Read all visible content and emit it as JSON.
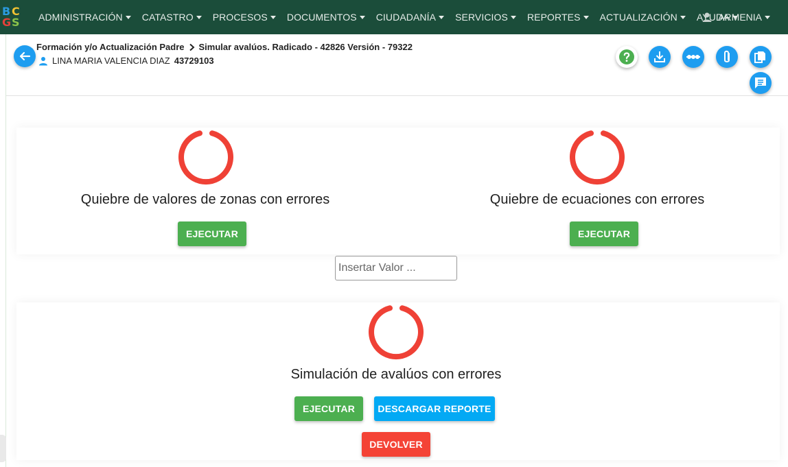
{
  "app": {
    "logo_letters": [
      "B",
      "C",
      "G",
      "S"
    ]
  },
  "navbar": {
    "items": [
      {
        "label": "ADMINISTRACIÓN"
      },
      {
        "label": "CATASTRO"
      },
      {
        "label": "PROCESOS"
      },
      {
        "label": "DOCUMENTOS"
      },
      {
        "label": "CIUDADANÍA"
      },
      {
        "label": "SERVICIOS"
      },
      {
        "label": "REPORTES"
      },
      {
        "label": "ACTUALIZACIÓN"
      },
      {
        "label": "AYUDA"
      }
    ],
    "user": {
      "label": "ARMENIA",
      "icon": "user-icon"
    }
  },
  "header": {
    "breadcrumb": {
      "parent": "Formación y/o Actualización Padre",
      "separator_icon": "chevron-right-icon",
      "current": "Simular avalúos. Radicado - 42826 Versión - 79322"
    },
    "person": {
      "icon": "person-icon",
      "name": "LINA MARIA VALENCIA DIAZ",
      "id": "43729103"
    },
    "actions": [
      {
        "icon": "help-icon"
      },
      {
        "icon": "download-icon"
      },
      {
        "icon": "timeline-icon"
      },
      {
        "icon": "attachment-icon"
      },
      {
        "icon": "copy-icon"
      },
      {
        "icon": "comment-icon"
      }
    ]
  },
  "sections": {
    "zonas": {
      "title": "Quiebre de valores de zonas con errores",
      "button": "EJECUTAR",
      "status_icon": "error-ring-icon"
    },
    "ecuaciones": {
      "title": "Quiebre de ecuaciones con errores",
      "button": "EJECUTAR",
      "status_icon": "error-ring-icon"
    },
    "input": {
      "placeholder": "Insertar Valor ..."
    },
    "simulacion": {
      "title": "Simulación de avalúos con errores",
      "execute_button": "EJECUTAR",
      "report_button": "DESCARGAR REPORTE",
      "return_button": "DEVOLVER",
      "status_icon": "error-ring-icon"
    }
  },
  "colors": {
    "navbar": "#1b4d3a",
    "accent_blue": "#1e9df0",
    "success": "#4caf50",
    "info": "#03a9f4",
    "danger": "#f44336",
    "error_ring": "#ef4136"
  }
}
